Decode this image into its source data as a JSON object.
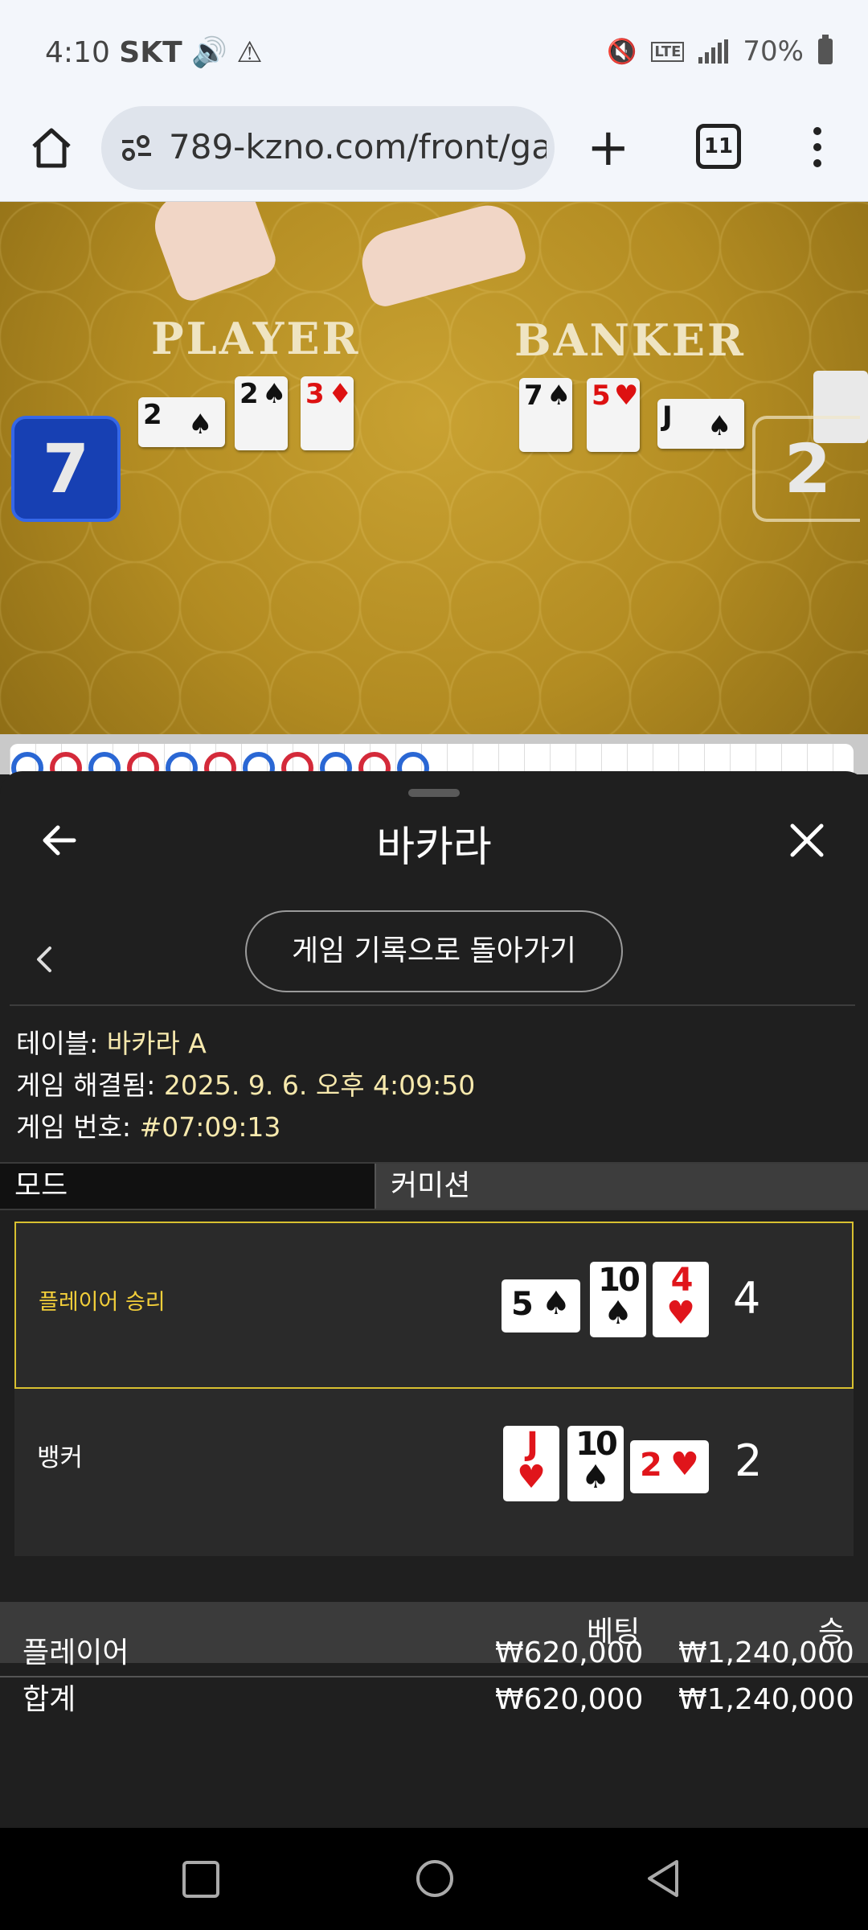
{
  "status": {
    "time": "4:10",
    "carrier": "SKT",
    "battery": "70%",
    "lte_label": "LTE"
  },
  "browser": {
    "url": "789-kzno.com/front/ga",
    "tab_count": "11"
  },
  "video": {
    "player_label": "PLAYER",
    "banker_label": "BANKER",
    "player_score": "7",
    "banker_score": "2",
    "player_cards": [
      {
        "rank": "2",
        "suit": "♠",
        "color": "blk"
      },
      {
        "rank": "2",
        "suit": "♠",
        "color": "blk"
      },
      {
        "rank": "3",
        "suit": "♦",
        "color": "red"
      }
    ],
    "banker_cards": [
      {
        "rank": "7",
        "suit": "♠",
        "color": "blk"
      },
      {
        "rank": "5",
        "suit": "♥",
        "color": "red"
      },
      {
        "rank": "J",
        "suit": "♠",
        "color": "blk"
      }
    ]
  },
  "road": {
    "beads": [
      "#2a67d4",
      "#d42a3a",
      "#2a67d4",
      "#d42a3a",
      "#2a67d4",
      "#d42a3a",
      "#2a67d4",
      "#d42a3a",
      "#2a67d4",
      "#d42a3a",
      "#2a67d4"
    ]
  },
  "sheet": {
    "title": "바카라",
    "back_to_history": "게임 기록으로 돌아가기",
    "table_label": "테이블:",
    "table_value": "바카라 A",
    "resolved_label": "게임 해결됨:",
    "resolved_value": "2025. 9. 6. 오후 4:09:50",
    "game_no_label": "게임 번호:",
    "game_no_value": "#07:09:13",
    "mode_label": "모드",
    "mode_value": "커미션"
  },
  "results": {
    "player": {
      "label": "플레이어 승리",
      "cards": [
        {
          "rank": "5",
          "suit": "♠",
          "color": "blk",
          "rotated": true
        },
        {
          "rank": "10",
          "suit": "♠",
          "color": "blk",
          "rotated": false
        },
        {
          "rank": "4",
          "suit": "♥",
          "color": "red",
          "rotated": false
        }
      ],
      "total": "4"
    },
    "banker": {
      "label": "뱅커",
      "cards": [
        {
          "rank": "J",
          "suit": "♥",
          "color": "red",
          "rotated": false
        },
        {
          "rank": "10",
          "suit": "♠",
          "color": "blk",
          "rotated": false
        },
        {
          "rank": "2",
          "suit": "♥",
          "color": "red",
          "rotated": true
        }
      ],
      "total": "2"
    }
  },
  "bets": {
    "col_bet": "베팅",
    "col_win": "승",
    "rows": [
      {
        "name": "플레이어",
        "bet": "₩620,000",
        "win": "₩1,240,000"
      },
      {
        "name": "합계",
        "bet": "₩620,000",
        "win": "₩1,240,000"
      }
    ]
  }
}
